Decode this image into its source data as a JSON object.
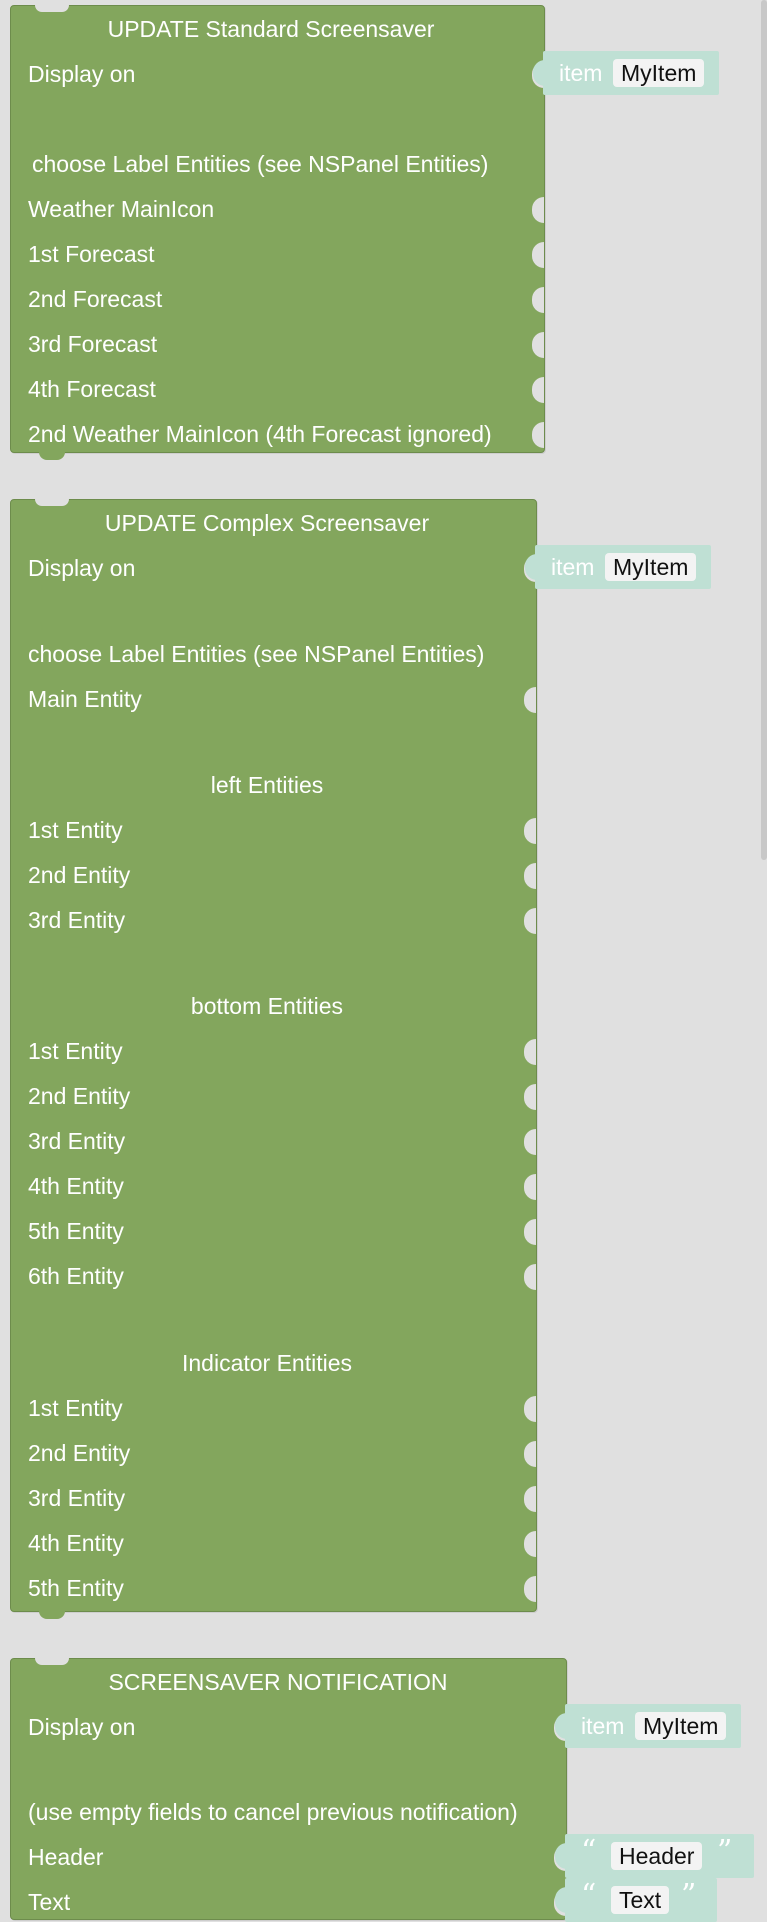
{
  "block1": {
    "title": "UPDATE Standard Screensaver",
    "display_on": "Display on",
    "item_label": "item",
    "item_value": "MyItem",
    "choose": "choose Label Entities (see NSPanel Entities)",
    "rows": [
      "Weather MainIcon",
      "1st Forecast",
      "2nd Forecast",
      "3rd Forecast",
      "4th Forecast",
      "2nd Weather MainIcon (4th Forecast ignored)"
    ]
  },
  "block2": {
    "title": "UPDATE Complex Screensaver",
    "display_on": "Display on",
    "item_label": "item",
    "item_value": "MyItem",
    "choose": "choose Label Entities (see NSPanel Entities)",
    "main": "Main Entity",
    "left_heading": "left Entities",
    "left": [
      "1st Entity",
      "2nd Entity",
      "3rd Entity"
    ],
    "bottom_heading": "bottom Entities",
    "bottom": [
      "1st Entity",
      "2nd Entity",
      "3rd Entity",
      "4th Entity",
      "5th Entity",
      "6th Entity"
    ],
    "indicator_heading": "Indicator Entities",
    "indicator": [
      "1st Entity",
      "2nd Entity",
      "3rd Entity",
      "4th Entity",
      "5th Entity"
    ]
  },
  "block3": {
    "title": "SCREENSAVER NOTIFICATION",
    "display_on": "Display on",
    "item_label": "item",
    "item_value": "MyItem",
    "note": "(use empty fields to cancel previous notification)",
    "header_label": "Header",
    "header_value": "Header",
    "text_label": "Text",
    "text_value": "Text",
    "open_quote": "“",
    "close_quote": "”"
  }
}
